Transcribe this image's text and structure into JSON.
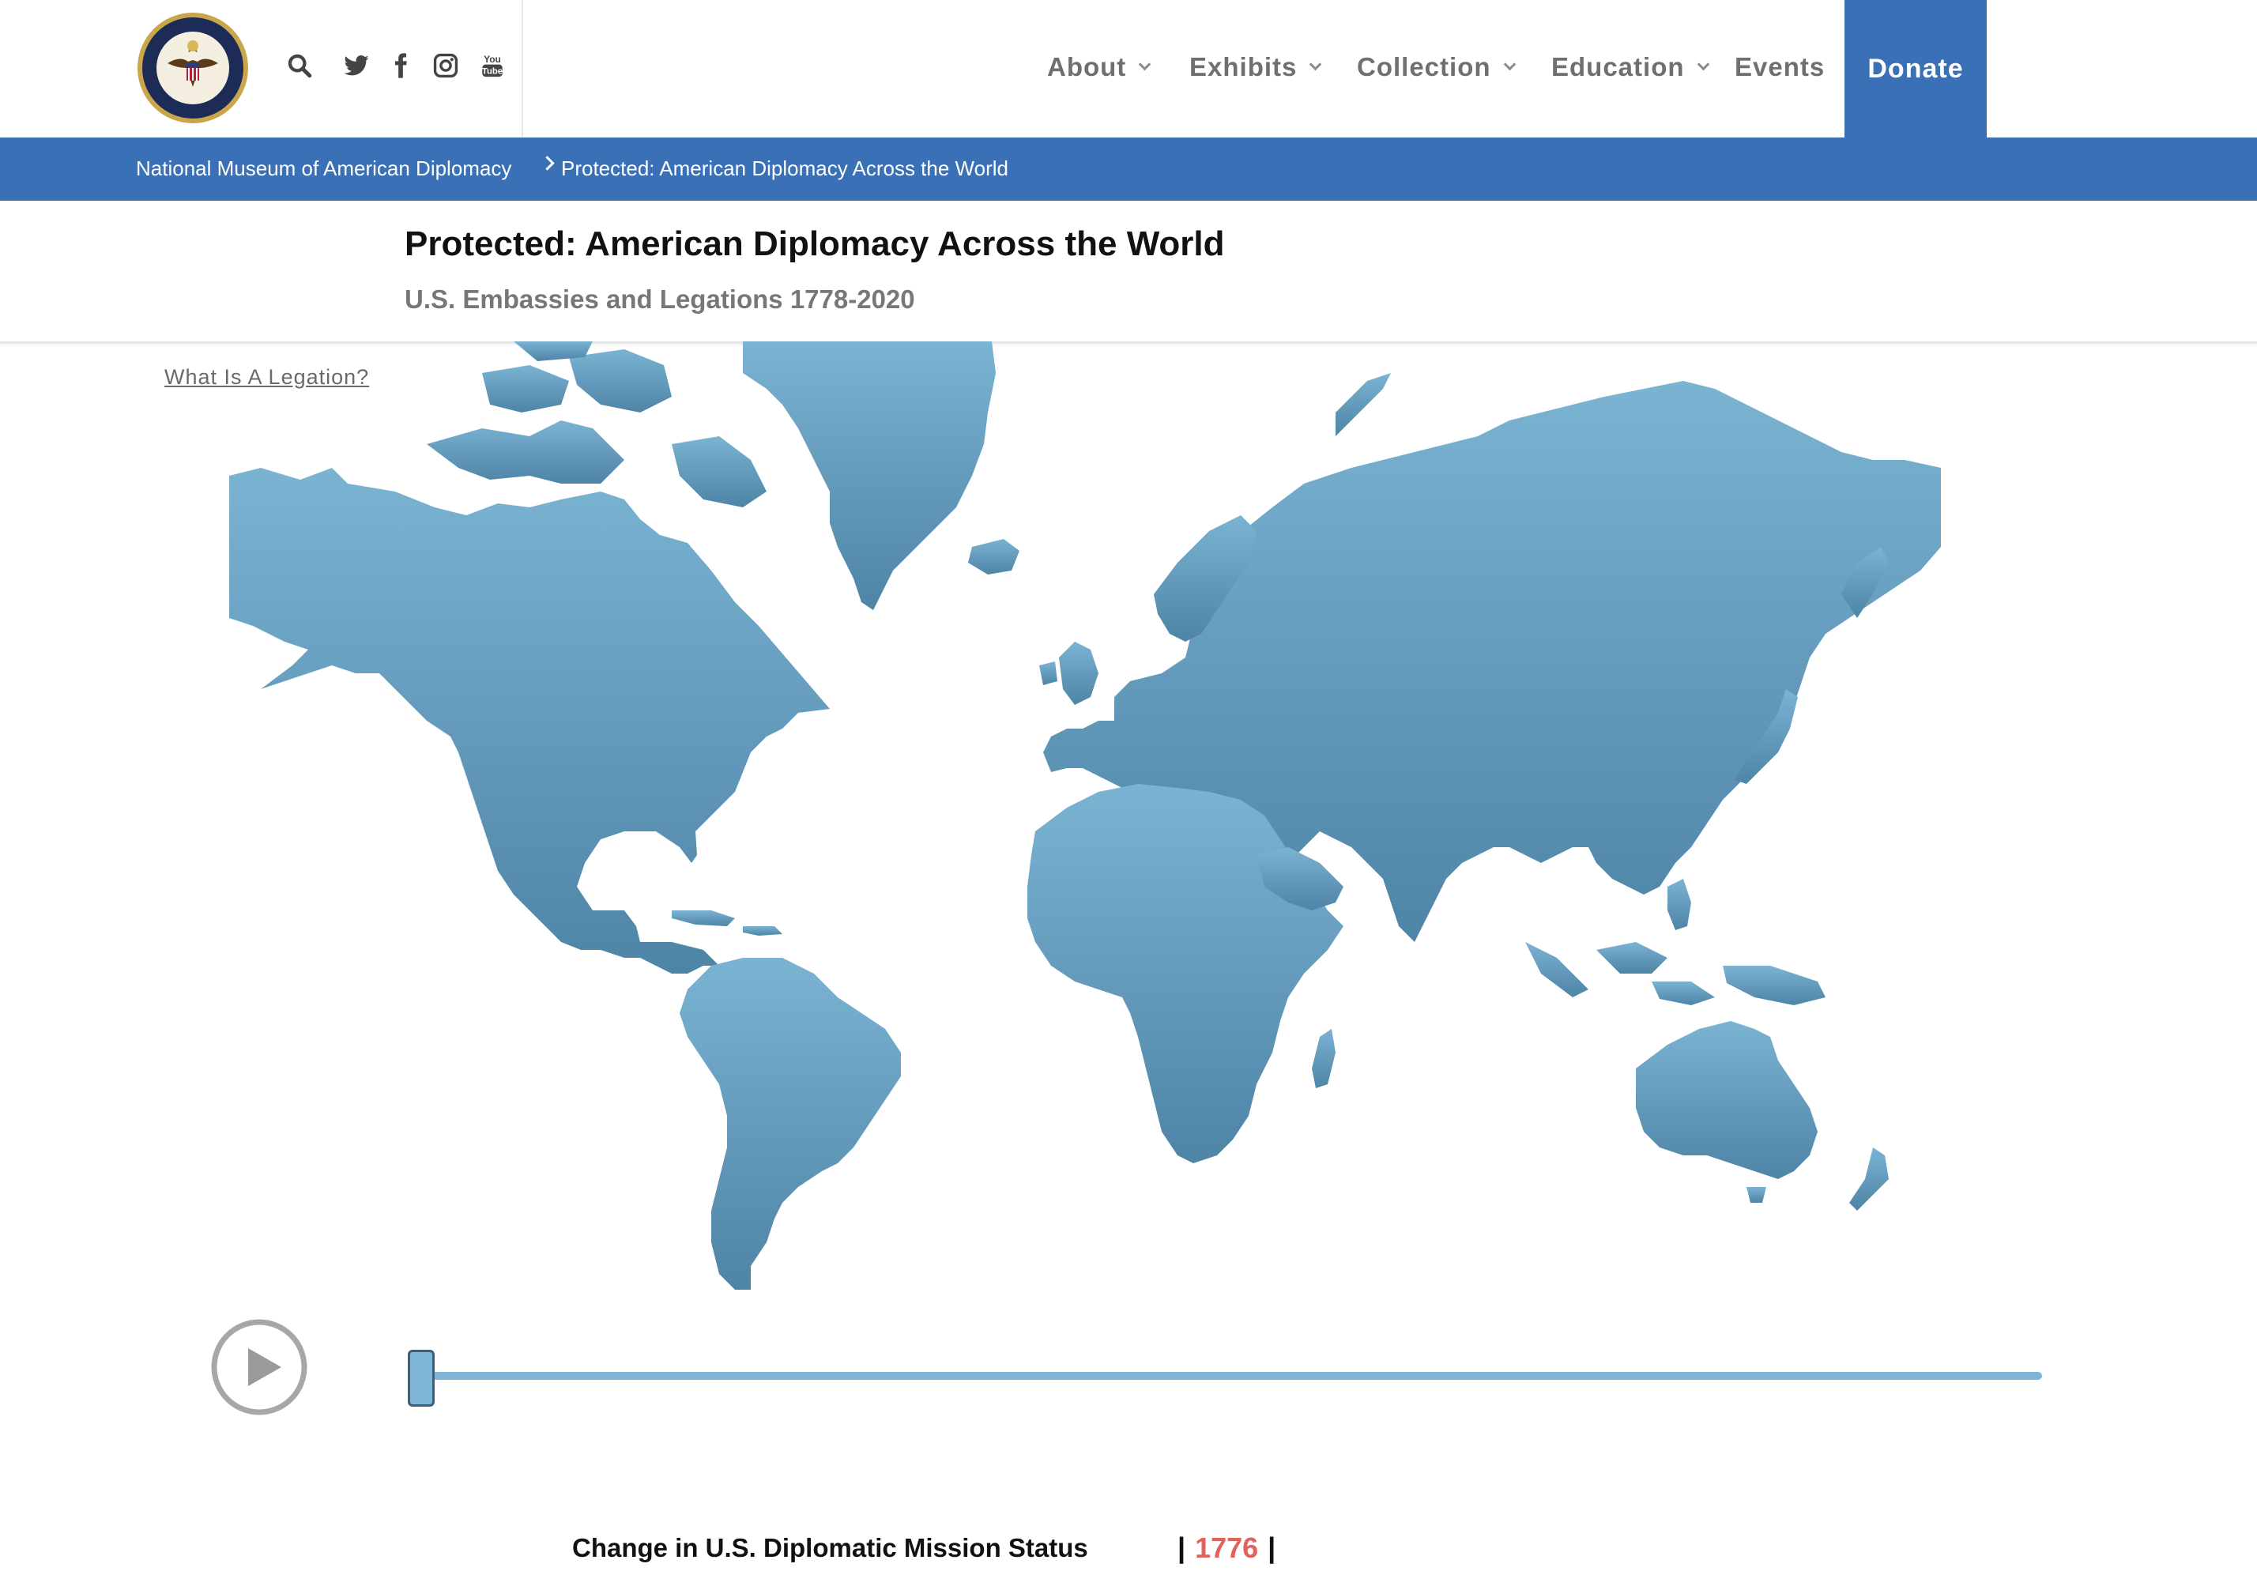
{
  "header": {
    "seal_text": "DEPARTMENT OF STATE · UNITED STATES OF AMERICA",
    "nav": [
      {
        "label": "About",
        "has_dropdown": true
      },
      {
        "label": "Exhibits",
        "has_dropdown": true
      },
      {
        "label": "Collection",
        "has_dropdown": true
      },
      {
        "label": "Education",
        "has_dropdown": true
      },
      {
        "label": "Events",
        "has_dropdown": false
      }
    ],
    "donate_label": "Donate",
    "social_icons": [
      "search-icon",
      "twitter-icon",
      "facebook-icon",
      "instagram-icon",
      "youtube-icon"
    ],
    "youtube_text": [
      "You",
      "Tube"
    ]
  },
  "breadcrumb": {
    "home": "National Museum of American Diplomacy",
    "current": "Protected: American Diplomacy Across the World"
  },
  "page": {
    "title": "Protected: American Diplomacy Across the World",
    "subtitle": "U.S. Embassies and Legations 1778-2020",
    "legation_link": "What Is A Legation?"
  },
  "timeline": {
    "year": "1776",
    "status_label": "Change in U.S. Diplomatic Mission Status",
    "bar_left": "|",
    "bar_right": "|",
    "slider_position": 0
  },
  "colors": {
    "brand_blue": "#3a70b5",
    "map_top": "#7bb3d3",
    "map_bottom": "#4e84a6",
    "slider": "#7fb5d6",
    "year_red": "#e0625b"
  }
}
